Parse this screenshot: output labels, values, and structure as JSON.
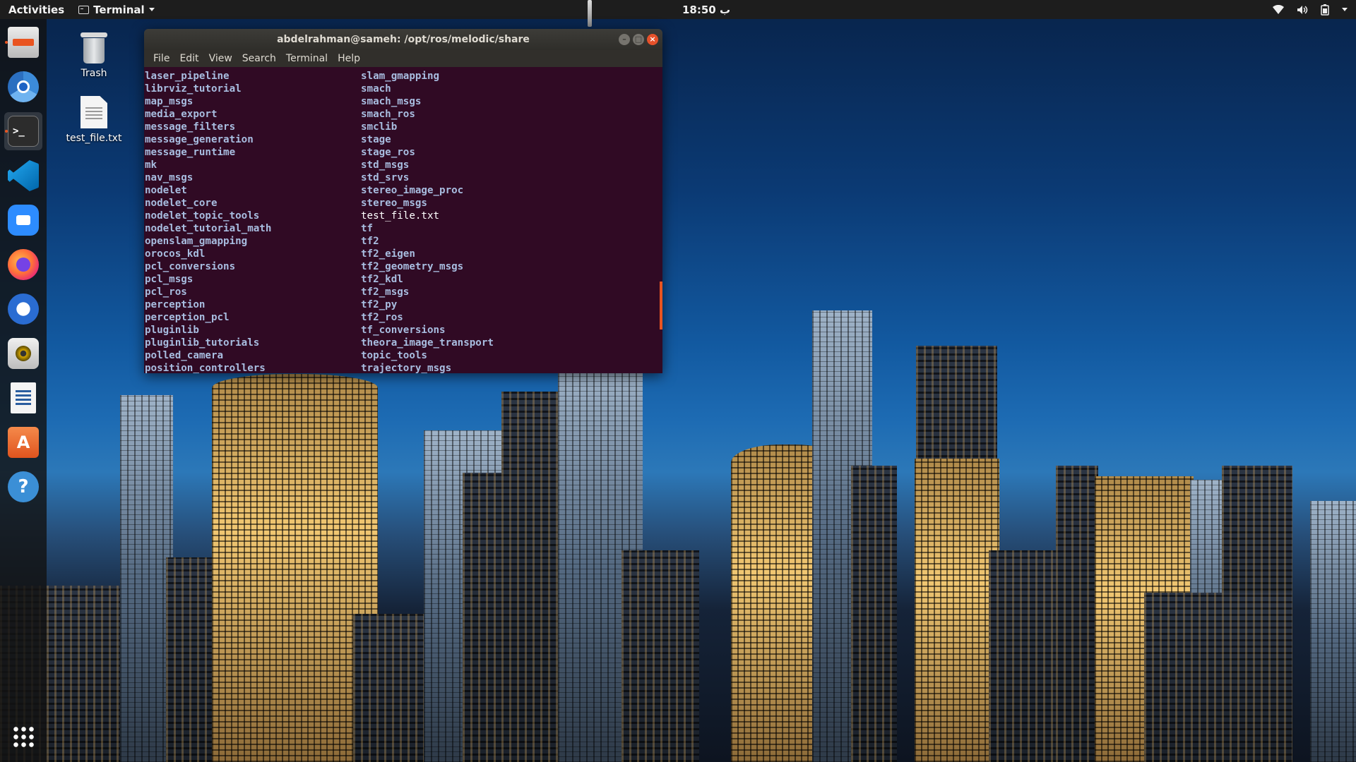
{
  "topbar": {
    "activities": "Activities",
    "app_name": "Terminal",
    "clock": "18:50 ب",
    "tray": {
      "wifi_icon": "wifi-icon",
      "volume_icon": "volume-icon",
      "battery_icon": "battery-icon"
    }
  },
  "dock": {
    "items": [
      {
        "name": "files",
        "icon": "file-cabinet-icon"
      },
      {
        "name": "chromium",
        "icon": "chromium-icon"
      },
      {
        "name": "terminal",
        "icon": "terminal-icon"
      },
      {
        "name": "vscode",
        "icon": "vscode-icon"
      },
      {
        "name": "zoom",
        "icon": "zoom-icon"
      },
      {
        "name": "firefox",
        "icon": "firefox-icon"
      },
      {
        "name": "thunderbird",
        "icon": "thunderbird-icon"
      },
      {
        "name": "rhythmbox",
        "icon": "rhythmbox-icon"
      },
      {
        "name": "writer",
        "icon": "writer-icon"
      },
      {
        "name": "software",
        "icon": "software-center-icon"
      },
      {
        "name": "help",
        "icon": "help-icon"
      },
      {
        "name": "show-apps",
        "icon": "app-grid-icon"
      }
    ]
  },
  "desktop": {
    "icons": [
      {
        "label": "Trash"
      },
      {
        "label": "test_file.txt"
      }
    ]
  },
  "terminal": {
    "title": "abdelrahman@sameh: /opt/ros/melodic/share",
    "menu": [
      "File",
      "Edit",
      "View",
      "Search",
      "Terminal",
      "Help"
    ],
    "col1": [
      "laser_pipeline",
      "librviz_tutorial",
      "map_msgs",
      "media_export",
      "message_filters",
      "message_generation",
      "message_runtime",
      "mk",
      "nav_msgs",
      "nodelet",
      "nodelet_core",
      "nodelet_topic_tools",
      "nodelet_tutorial_math",
      "openslam_gmapping",
      "orocos_kdl",
      "pcl_conversions",
      "pcl_msgs",
      "pcl_ros",
      "perception",
      "perception_pcl",
      "pluginlib",
      "pluginlib_tutorials",
      "polled_camera",
      "position_controllers"
    ],
    "col2": [
      "slam_gmapping",
      "smach",
      "smach_msgs",
      "smach_ros",
      "smclib",
      "stage",
      "stage_ros",
      "std_msgs",
      "std_srvs",
      "stereo_image_proc",
      "stereo_msgs",
      "test_file.txt",
      "tf",
      "tf2",
      "tf2_eigen",
      "tf2_geometry_msgs",
      "tf2_kdl",
      "tf2_msgs",
      "tf2_py",
      "tf2_ros",
      "tf_conversions",
      "theora_image_transport",
      "topic_tools",
      "trajectory_msgs"
    ],
    "plain_file": "test_file.txt"
  },
  "colors": {
    "terminal_bg": "#300a24",
    "directory_text": "#a8bde0",
    "accent": "#e95420"
  }
}
